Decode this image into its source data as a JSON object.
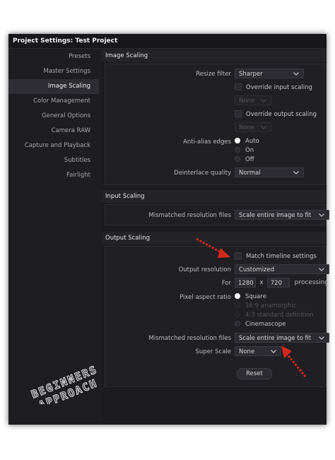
{
  "window": {
    "title": "Project Settings:  Test Project"
  },
  "sidebar": {
    "items": [
      {
        "label": "Presets"
      },
      {
        "label": "Master Settings"
      },
      {
        "label": "Image Scaling"
      },
      {
        "label": "Color Management"
      },
      {
        "label": "General Options"
      },
      {
        "label": "Camera RAW"
      },
      {
        "label": "Capture and Playback"
      },
      {
        "label": "Subtitles"
      },
      {
        "label": "Fairlight"
      }
    ]
  },
  "image_scaling": {
    "header": "Image Scaling",
    "resize_filter_label": "Resize filter",
    "resize_filter_value": "Sharper",
    "override_input_label": "Override input scaling",
    "input_none": "None",
    "override_output_label": "Override output scaling",
    "output_none": "None",
    "anti_alias_label": "Anti-alias edges",
    "aa_auto": "Auto",
    "aa_on": "On",
    "aa_off": "Off",
    "deinterlace_label": "Deinterlace quality",
    "deinterlace_value": "Normal"
  },
  "input_scaling": {
    "header": "Input Scaling",
    "mismatch_label": "Mismatched resolution files",
    "mismatch_value": "Scale entire image to fit"
  },
  "output_scaling": {
    "header": "Output Scaling",
    "match_timeline_label": "Match timeline settings",
    "output_res_label": "Output resolution",
    "output_res_value": "Customized",
    "for_label": "For",
    "width": "1280",
    "x_label": "x",
    "height": "720",
    "processing_label": "processing",
    "par_label": "Pixel aspect ratio",
    "par_square": "Square",
    "par_169": "16:9 anamorphic",
    "par_43": "4:3 standard definition",
    "par_cinemascope": "Cinemascope",
    "mismatch_label": "Mismatched resolution files",
    "mismatch_value": "Scale entire image to fit",
    "super_scale_label": "Super Scale",
    "super_scale_value": "None",
    "reset_label": "Reset"
  },
  "colors": {
    "annotation_arrow": "#d42a1e",
    "active_sidebar": "#2d2d33",
    "background": "#1c1c20"
  },
  "watermark": {
    "line1": "BEGINNERS",
    "line2": "APPROACH"
  }
}
